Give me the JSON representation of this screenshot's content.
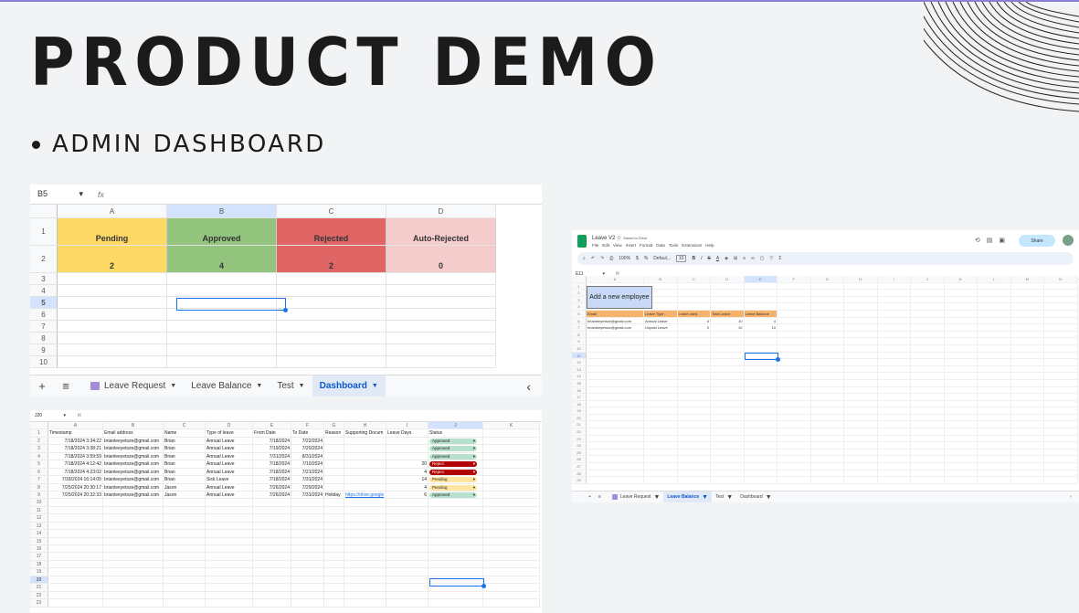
{
  "slide": {
    "title": "PRODUCT DEMO",
    "bullet": "ADMIN DASHBOARD"
  },
  "dashboard": {
    "cell_ref": "B5",
    "columns": [
      "A",
      "B",
      "C",
      "D"
    ],
    "rows": [
      "1",
      "2",
      "3",
      "4",
      "5",
      "6",
      "7",
      "8",
      "9",
      "10"
    ],
    "stats": [
      {
        "label": "Pending",
        "value": "2",
        "color": "#ffd966"
      },
      {
        "label": "Approved",
        "value": "4",
        "color": "#93c47d"
      },
      {
        "label": "Rejected",
        "value": "2",
        "color": "#e06666"
      },
      {
        "label": "Auto-Rejected",
        "value": "0",
        "color": "#f4cccc"
      }
    ],
    "tabs": [
      "Leave Request",
      "Leave Balance",
      "Test",
      "Dashboard"
    ],
    "active_tab": "Dashboard"
  },
  "requests": {
    "cell_ref": "J20",
    "columns": [
      "A",
      "B",
      "C",
      "D",
      "E",
      "F",
      "G",
      "H",
      "I",
      "J",
      "K"
    ],
    "headers": [
      "Timestamp",
      "Email address",
      "Name",
      "Type of leave",
      "From Date",
      "To Date",
      "Reason",
      "Supporting Docum",
      "Leave Days",
      "Status",
      ""
    ],
    "rows": [
      [
        "7/18/2024 3:34:22",
        "brianleeyetsze@gmail.com",
        "Brian",
        "Annual Leave",
        "7/18/2024",
        "7/22/2024",
        "",
        "",
        "",
        "Approved",
        ""
      ],
      [
        "7/18/2024 3:38:21",
        "brianleeyetsze@gmail.com",
        "Brian",
        "Annual Leave",
        "7/19/2024",
        "7/20/2024",
        "",
        "",
        "",
        "Approved",
        ""
      ],
      [
        "7/18/2024 3:59:59",
        "brianleeyetsze@gmail.com",
        "Brian",
        "Annual Leave",
        "7/31/2024",
        "8/31/2024",
        "",
        "",
        "",
        "Approved",
        ""
      ],
      [
        "7/18/2024 4:12:42",
        "brianleeyetsze@gmail.com",
        "Brian",
        "Annual Leave",
        "7/18/2024",
        "7/10/2024",
        "",
        "",
        "20",
        "Reject",
        ""
      ],
      [
        "7/18/2024 4:23:02",
        "brianleeyetsze@gmail.com",
        "Brian",
        "Annual Leave",
        "7/18/2024",
        "7/21/2024",
        "",
        "",
        "4",
        "Reject",
        ""
      ],
      [
        "7/18/2024 16:14:05",
        "brianleeyetsze@gmail.com",
        "Brian",
        "Sick Leave",
        "7/18/2024",
        "7/31/2024",
        "",
        "",
        "14",
        "Pending",
        ""
      ],
      [
        "7/25/2024 20:30:17",
        "brianleeyetsze@gmail.com",
        "Jason",
        "Annual Leave",
        "7/26/2024",
        "7/29/2024",
        "",
        "",
        "4",
        "Pending",
        ""
      ],
      [
        "7/25/2024 20:32:33",
        "brianleeyetsze@gmail.com",
        "Jason",
        "Annual Leave",
        "7/26/2024",
        "7/31/2024",
        "Holiday",
        "https://drive.google",
        "6",
        "Approved",
        ""
      ]
    ],
    "status_colors": {
      "Approved": "#b7e1cd",
      "Reject": "#b10202",
      "Pending": "#ffe5a0"
    }
  },
  "balance": {
    "doc_title": "Leave V2",
    "saved": "Saved to Drive",
    "menus": [
      "File",
      "Edit",
      "View",
      "Insert",
      "Format",
      "Data",
      "Tools",
      "Extensions",
      "Help"
    ],
    "share": "Share",
    "zoom": "100%",
    "font": "Defaul...",
    "font_size": "10",
    "cell_ref": "E11",
    "columns": [
      "A",
      "B",
      "C",
      "D",
      "E",
      "F",
      "G",
      "H",
      "I",
      "J",
      "K",
      "L",
      "M",
      "N"
    ],
    "add_button": "Add a new employee",
    "headers": [
      "Email",
      "Leave Type",
      "Leave used",
      "Total Leave",
      "Leave Balance"
    ],
    "rows": [
      [
        "brianleeyetsze@gmail.com",
        "Annual Leave",
        "6",
        "10",
        "4"
      ],
      [
        "brianleeyetsze@gmail.com",
        "Unpaid Leave",
        "0",
        "10",
        "10"
      ]
    ],
    "tabs": [
      "Leave Request",
      "Leave Balance",
      "Test",
      "Dashboard"
    ],
    "active_tab": "Leave Balance"
  }
}
